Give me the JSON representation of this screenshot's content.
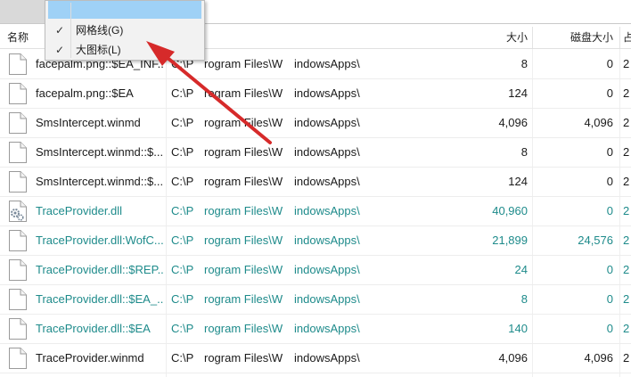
{
  "colors": {
    "teal_text": "#1e8b8b",
    "arrow": "#d62a2a",
    "menu_highlight": "#9fd1f6"
  },
  "columns": {
    "name": "名称",
    "size": "大小",
    "disk_size": "磁盘大小",
    "extra": "占"
  },
  "menu": {
    "items": [
      {
        "label": "网格线(G)",
        "checked": "✓"
      },
      {
        "label": "大图标(L)",
        "checked": "✓"
      }
    ]
  },
  "rows": [
    {
      "name": "facepalm.png::$EA_INF...",
      "path1": "C:\\P",
      "path2": "rogram Files\\W",
      "path3": "indowsApps\\",
      "size": "8",
      "disk": "0",
      "extra": "2",
      "teal": false,
      "icon": "file-icon"
    },
    {
      "name": "facepalm.png::$EA",
      "path1": "C:\\P",
      "path2": "rogram Files\\W",
      "path3": "indowsApps\\",
      "size": "124",
      "disk": "0",
      "extra": "2",
      "teal": false,
      "icon": "file-icon"
    },
    {
      "name": "SmsIntercept.winmd",
      "path1": "C:\\P",
      "path2": "rogram Files\\W",
      "path3": "indowsApps\\",
      "size": "4,096",
      "disk": "4,096",
      "extra": "2",
      "teal": false,
      "icon": "file-icon"
    },
    {
      "name": "SmsIntercept.winmd::$...",
      "path1": "C:\\P",
      "path2": "rogram Files\\W",
      "path3": "indowsApps\\",
      "size": "8",
      "disk": "0",
      "extra": "2",
      "teal": false,
      "icon": "file-icon"
    },
    {
      "name": "SmsIntercept.winmd::$...",
      "path1": "C:\\P",
      "path2": "rogram Files\\W",
      "path3": "indowsApps\\",
      "size": "124",
      "disk": "0",
      "extra": "2",
      "teal": false,
      "icon": "file-icon"
    },
    {
      "name": "TraceProvider.dll",
      "path1": "C:\\P",
      "path2": "rogram Files\\W",
      "path3": "indowsApps\\",
      "size": "40,960",
      "disk": "0",
      "extra": "2",
      "teal": true,
      "icon": "dll-gear-icon"
    },
    {
      "name": "TraceProvider.dll:WofC...",
      "path1": "C:\\P",
      "path2": "rogram Files\\W",
      "path3": "indowsApps\\",
      "size": "21,899",
      "disk": "24,576",
      "extra": "2",
      "teal": true,
      "icon": "file-icon"
    },
    {
      "name": "TraceProvider.dll::$REP...",
      "path1": "C:\\P",
      "path2": "rogram Files\\W",
      "path3": "indowsApps\\",
      "size": "24",
      "disk": "0",
      "extra": "2",
      "teal": true,
      "icon": "file-icon"
    },
    {
      "name": "TraceProvider.dll::$EA_...",
      "path1": "C:\\P",
      "path2": "rogram Files\\W",
      "path3": "indowsApps\\",
      "size": "8",
      "disk": "0",
      "extra": "2",
      "teal": true,
      "icon": "file-icon"
    },
    {
      "name": "TraceProvider.dll::$EA",
      "path1": "C:\\P",
      "path2": "rogram Files\\W",
      "path3": "indowsApps\\",
      "size": "140",
      "disk": "0",
      "extra": "2",
      "teal": true,
      "icon": "file-icon"
    },
    {
      "name": "TraceProvider.winmd",
      "path1": "C:\\P",
      "path2": "rogram Files\\W",
      "path3": "indowsApps\\",
      "size": "4,096",
      "disk": "4,096",
      "extra": "2",
      "teal": false,
      "icon": "file-icon"
    }
  ]
}
